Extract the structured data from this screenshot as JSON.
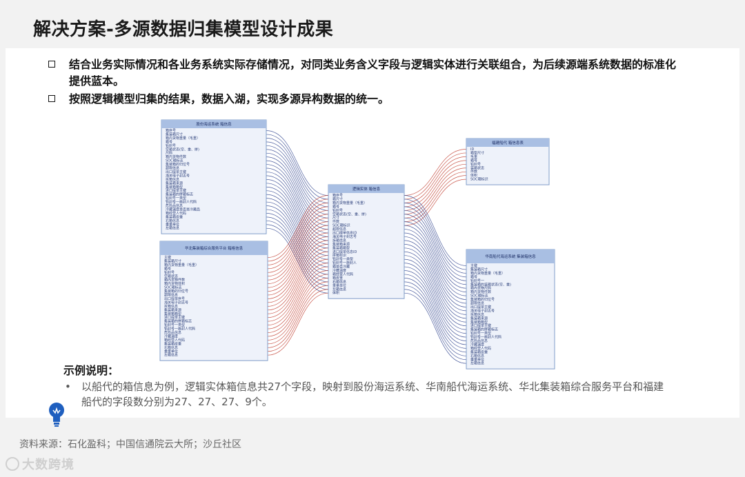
{
  "title": "解决方案-多源数据归集模型设计成果",
  "bullets": [
    "结合业务实际情况和各业务系统实际存储情况，对同类业务含义字段与逻辑实体进行关联组合，为后续源端系统数据的标准化提供蓝本。",
    "按照逻辑模型归集的结果，数据入湖，实现多源异构数据的统一。"
  ],
  "diagram": {
    "entities": [
      {
        "id": "gufen",
        "header": "股份海运系统 箱信息",
        "fields": [
          "箱序号",
          "集装箱尺寸",
          "箱内货物重量（毛重）",
          "箱号",
          "铅封号",
          "空箱状态(空、重、拼)",
          "尺码",
          "箱内货物件数",
          "SOC箱标志",
          "集装箱的归位号",
          "超限信息",
          "出口提单主键",
          "海关电子封志号",
          "拆箱信息",
          "集装箱来源",
          "集装箱箱型",
          "进口提单主键",
          "集装箱的拼箱标志",
          "铅封号一类型",
          "铅封号一施封人代码",
          "危险品信息",
          "冷藏温度是否是冷藏品",
          "箱经营人代码",
          "集装箱皮重",
          "右箱信息",
          "重量单位",
          "左箱信息"
        ]
      },
      {
        "id": "huabei",
        "header": "华北集装箱综合服务平台 箱格信息",
        "fields": [
          "主键",
          "集装箱尺寸",
          "箱内货物重量（毛重）",
          "箱号",
          "铅封号",
          "空箱状态",
          "箱内货物件数",
          "箱内货物体积",
          "SOC箱标志",
          "集装箱的归位号",
          "超限信息",
          "出口提单序号",
          "海关电子封志号",
          "拆箱信息",
          "集装箱来源",
          "集装箱箱型",
          "进口提单主键",
          "集装箱的拼箱标志",
          "铅封号一类型",
          "铅封号一施封人代码",
          "危险品信息",
          "冷藏温度",
          "箱经营人代码",
          "集装箱皮重",
          "右箱信息",
          "重量单位",
          "左箱信息"
        ]
      },
      {
        "id": "logic",
        "header": "逻辑实体 箱信息",
        "fields": [
          "箱序号",
          "箱尺寸",
          "箱内货物重量（毛重）",
          "箱号",
          "铅封号",
          "空箱状态(空、重、拼)",
          "尺寸",
          "件数",
          "SOC箱标识",
          "超限信息",
          "出口提单信息ID",
          "海关电子封志号",
          "拆箱信息",
          "集装箱来源",
          "集装箱箱型",
          "进口提单信息ID",
          "拼箱标识",
          "铅封号一类型",
          "铅封号一施封人",
          "箱是否冷藏",
          "冷藏温度",
          "箱经营人代码",
          "箱皮重",
          "右箱信息",
          "重量单位",
          "左箱信息",
          "体积"
        ]
      },
      {
        "id": "fujian",
        "header": "福建船代 箱信息表",
        "fields": [
          "ID",
          "箱型尺寸",
          "毛重",
          "箱号",
          "铅封号",
          "装箱状态",
          "件数",
          "体积",
          "SOC箱标识"
        ]
      },
      {
        "id": "huanan",
        "header": "华南船代海运系统 集装箱信息",
        "fields": [
          "主键",
          "集装箱尺寸",
          "箱内货物重量（毛重）",
          "箱号",
          "铅封号一",
          "集装箱的装箱状态(空、重)",
          "箱内货物尺码",
          "箱内货物件数",
          "SOC箱标志",
          "集装箱的归位号",
          "超限信息",
          "出口提单主键",
          "海关电子封志号",
          "拆箱信息",
          "集装箱来源",
          "集装箱箱型",
          "进口提单主键",
          "集装箱的拼箱标志",
          "铅封号一类型",
          "铅封号一施封人代码",
          "危险品信息",
          "冷藏温度",
          "箱经营人代码",
          "集装箱皮重",
          "右箱信息",
          "重量单位",
          "左箱信息"
        ]
      }
    ]
  },
  "colors": {
    "entity_header": "#a9bfe3",
    "entity_body": "#eef2fa",
    "entity_border": "#7f9cc8",
    "line_blue": "#2c3f8c",
    "line_red": "#c0392b"
  },
  "example": {
    "title": "示例说明：",
    "bullet": "•",
    "text": "以船代的箱信息为例，逻辑实体箱信息共27个字段，映射到股份海运系统、华南船代海运系统、华北集装箱综合服务平台和福建船代的字段数分别为27、27、27、9个。",
    "icon": "lightbulb-icon"
  },
  "source": "资料来源：石化盈科；中国信通院云大所；沙丘社区",
  "watermark": "大数跨境"
}
